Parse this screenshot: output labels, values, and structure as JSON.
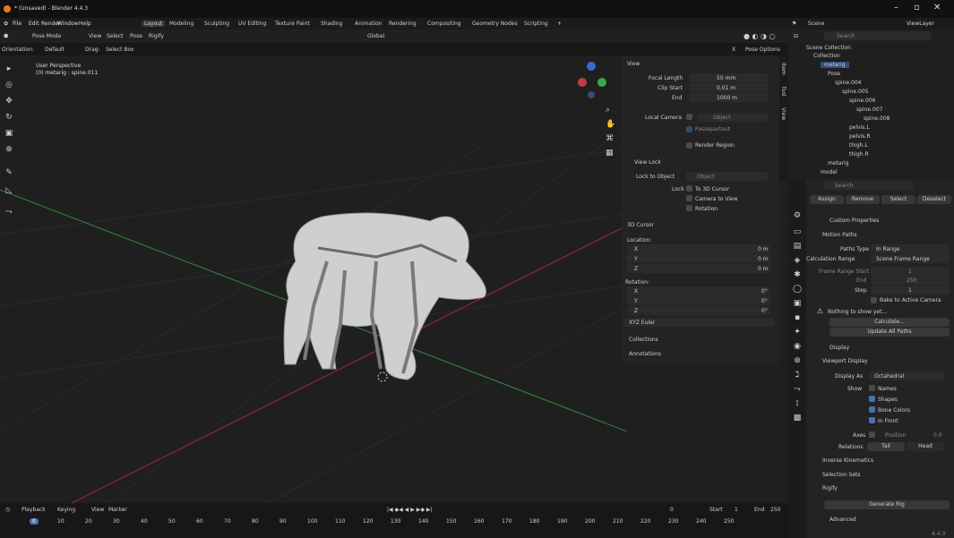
{
  "window": {
    "title": "* (Unsaved) - Blender 4.4.3"
  },
  "menu": [
    "File",
    "Edit",
    "Render",
    "Window",
    "Help"
  ],
  "workspace_tabs": [
    "Layout",
    "Modeling",
    "Sculpting",
    "UV Editing",
    "Texture Paint",
    "Shading",
    "Animation",
    "Rendering",
    "Compositing",
    "Geometry Nodes",
    "Scripting",
    "+"
  ],
  "scene": {
    "scene_name": "Scene",
    "view_layer": "ViewLayer",
    "search_placeholder": "Search"
  },
  "header": {
    "mode": "Pose Mode",
    "view": "View",
    "select": "Select",
    "pose": "Pose",
    "rigify": "Rigify",
    "transform": "Global"
  },
  "orient": {
    "orientation_label": "Orientation:",
    "orientation_value": "Default",
    "drag_label": "Drag:",
    "drag_value": "Select Box",
    "x_label": "X",
    "pose_options": "Pose Options"
  },
  "viewport": {
    "perspective": "User Perspective",
    "active": "(0) metarig : spine.011"
  },
  "side_tabs": [
    "Item",
    "Tool",
    "View"
  ],
  "npanel": {
    "view_title": "View",
    "focal_length_label": "Focal Length",
    "focal_length": "50 mm",
    "clip_start_label": "Clip Start",
    "clip_start": "0.01 m",
    "end_label": "End",
    "clip_end": "1000 m",
    "local_camera_label": "Local Camera",
    "camera_placeholder": "Object",
    "passepartout": "Passepartout",
    "render_region": "Render Region",
    "view_lock_title": "View Lock",
    "lock_to_object_label": "Lock to Object",
    "lock_object_placeholder": "Object",
    "lock_label": "Lock",
    "to_3d_cursor": "To 3D Cursor",
    "camera_to_view": "Camera to View",
    "rotation_cb": "Rotation",
    "cursor_title": "3D Cursor",
    "location_label": "Location:",
    "lx": "0 m",
    "ly": "0 m",
    "lz": "0 m",
    "rotation_label": "Rotation:",
    "rx": "0°",
    "ry": "0°",
    "rz": "0°",
    "axis_x": "X",
    "axis_y": "Y",
    "axis_z": "Z",
    "euler": "XYZ Euler",
    "collections": "Collections",
    "annotations": "Annotations"
  },
  "outliner": {
    "scene_collection": "Scene Collection",
    "items": [
      {
        "label": "Collection",
        "indent": 0
      },
      {
        "label": "metarig",
        "indent": 1
      },
      {
        "label": "Pose",
        "indent": 2
      },
      {
        "label": "spine.004",
        "indent": 3
      },
      {
        "label": "spine.005",
        "indent": 4
      },
      {
        "label": "spine.006",
        "indent": 5
      },
      {
        "label": "spine.007",
        "indent": 6
      },
      {
        "label": "spine.008",
        "indent": 7
      },
      {
        "label": "pelvis.L",
        "indent": 5
      },
      {
        "label": "pelvis.R",
        "indent": 5
      },
      {
        "label": "thigh.L",
        "indent": 5
      },
      {
        "label": "thigh.R",
        "indent": 5
      },
      {
        "label": "metarig",
        "indent": 2
      },
      {
        "label": "model",
        "indent": 1
      }
    ]
  },
  "properties": {
    "search_placeholder": "Search",
    "top_buttons": [
      "Assign",
      "Remove",
      "Select",
      "Deselect"
    ],
    "custom_props": "Custom Properties",
    "motion_paths": "Motion Paths",
    "paths_type_label": "Paths Type",
    "paths_type": "In Range",
    "calc_range_label": "Calculation Range",
    "calc_range": "Scene Frame Range",
    "frame_start_label": "Frame Range Start",
    "frame_start": "1",
    "end_label": "End",
    "frame_end": "250",
    "step_label": "Step",
    "step": "1",
    "bake_cam": "Bake to Active Camera",
    "nothing": "Nothing to show yet...",
    "calculate": "Calculate...",
    "update_all": "Update All Paths",
    "display": "Display",
    "viewport_display": "Viewport Display",
    "display_as_label": "Display As",
    "display_as": "Octahedral",
    "show_label": "Show",
    "names": "Names",
    "shapes": "Shapes",
    "bone_colors": "Bone Colors",
    "in_front": "In Front",
    "axes_label": "Axes",
    "position_label": "Position",
    "position_value": "0.0",
    "relations_label": "Relations",
    "tail": "Tail",
    "head": "Head",
    "inverse_kinematics": "Inverse Kinematics",
    "selection_sets": "Selection Sets",
    "rigify": "Rigify",
    "generate_rig": "Generate Rig",
    "advanced": "Advanced"
  },
  "timeline": {
    "playback": "Playback",
    "keying": "Keying",
    "view": "View",
    "marker": "Marker",
    "current_frame": "0",
    "start_label": "Start",
    "start": "1",
    "end_label": "End",
    "end": "250",
    "ticks": [
      "0",
      "10",
      "20",
      "30",
      "40",
      "50",
      "60",
      "70",
      "80",
      "90",
      "100",
      "110",
      "120",
      "130",
      "140",
      "150",
      "160",
      "170",
      "180",
      "190",
      "200",
      "210",
      "220",
      "230",
      "240",
      "250"
    ]
  },
  "version": "4.4.3"
}
